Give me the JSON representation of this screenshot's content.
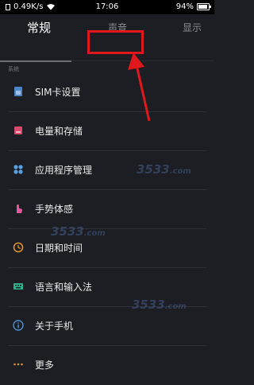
{
  "status_bar": {
    "network_speed": "0.49K/s",
    "time": "17:06",
    "battery": "94%",
    "battery_level": 0.94
  },
  "tabs": [
    {
      "label": "常规",
      "active": true
    },
    {
      "label": "声音",
      "active": false,
      "highlighted": true
    },
    {
      "label": "显示",
      "active": false
    }
  ],
  "section_title": "系统",
  "items": [
    {
      "label": "SIM卡设置",
      "icon": "sim-card-icon"
    },
    {
      "label": "电量和存储",
      "icon": "battery-storage-icon"
    },
    {
      "label": "应用程序管理",
      "icon": "apps-icon"
    },
    {
      "label": "手势体感",
      "icon": "gesture-icon"
    },
    {
      "label": "日期和时间",
      "icon": "clock-icon"
    },
    {
      "label": "语言和输入法",
      "icon": "language-icon"
    },
    {
      "label": "关于手机",
      "icon": "info-icon"
    },
    {
      "label": "更多",
      "icon": "more-icon"
    }
  ],
  "watermark": {
    "main": "3533",
    "suffix": ".com"
  },
  "colors": {
    "background": "#1c1e23",
    "highlight_box": "#e0171b",
    "arrow": "#e0171b"
  }
}
